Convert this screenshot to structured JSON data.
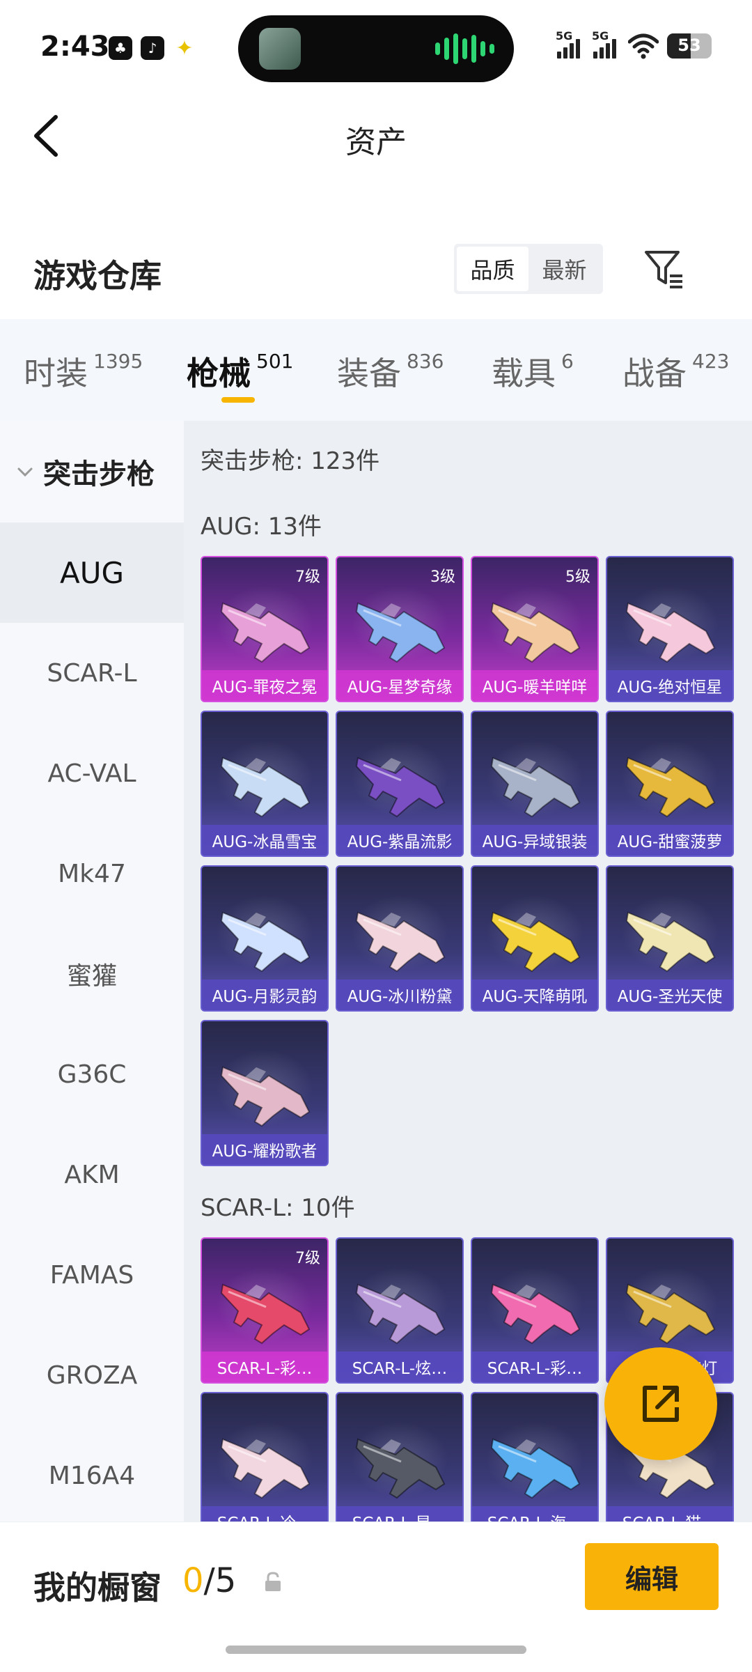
{
  "status_bar": {
    "time": "2:43",
    "signal1": "5G",
    "signal2": "5G",
    "battery": "53"
  },
  "header": {
    "title": "资产"
  },
  "toolbar": {
    "section_title": "游戏仓库",
    "sort_options": [
      "品质",
      "最新"
    ],
    "sort_active": "品质"
  },
  "tabs": [
    {
      "label": "时装",
      "count": "1395"
    },
    {
      "label": "枪械",
      "count": "501",
      "active": true
    },
    {
      "label": "装备",
      "count": "836"
    },
    {
      "label": "载具",
      "count": "6"
    },
    {
      "label": "战备",
      "count": "423"
    }
  ],
  "sidebar": {
    "category": "突击步枪",
    "items": [
      "AUG",
      "SCAR-L",
      "AC-VAL",
      "Mk47",
      "蜜獾",
      "G36C",
      "AKM",
      "FAMAS",
      "GROZA",
      "M16A4"
    ],
    "active": "AUG"
  },
  "content": {
    "category_total": "突击步枪: 123件",
    "groups": [
      {
        "heading": "AUG: 13件",
        "items": [
          {
            "name": "AUG-罪夜之冕",
            "level": "7级",
            "rarity": "rare"
          },
          {
            "name": "AUG-星梦奇缘",
            "level": "3级",
            "rarity": "rare"
          },
          {
            "name": "AUG-暖羊咩咩",
            "level": "5级",
            "rarity": "rare"
          },
          {
            "name": "AUG-绝对恒星",
            "level": "",
            "rarity": "epic"
          },
          {
            "name": "AUG-冰晶雪宝",
            "level": "",
            "rarity": "epic"
          },
          {
            "name": "AUG-紫晶流影",
            "level": "",
            "rarity": "epic"
          },
          {
            "name": "AUG-异域银装",
            "level": "",
            "rarity": "epic"
          },
          {
            "name": "AUG-甜蜜菠萝",
            "level": "",
            "rarity": "epic"
          },
          {
            "name": "AUG-月影灵韵",
            "level": "",
            "rarity": "epic"
          },
          {
            "name": "AUG-冰川粉黛",
            "level": "",
            "rarity": "epic"
          },
          {
            "name": "AUG-天降萌吼",
            "level": "",
            "rarity": "epic"
          },
          {
            "name": "AUG-圣光天使",
            "level": "",
            "rarity": "epic"
          },
          {
            "name": "AUG-耀粉歌者",
            "level": "",
            "rarity": "epic"
          }
        ]
      },
      {
        "heading": "SCAR-L: 10件",
        "items": [
          {
            "name": "SCAR-L-彩…",
            "level": "7级",
            "rarity": "rare"
          },
          {
            "name": "SCAR-L-炫…",
            "level": "",
            "rarity": "epic"
          },
          {
            "name": "SCAR-L-彩…",
            "level": "",
            "rarity": "epic"
          },
          {
            "name": "SCAR-L-夜灯",
            "level": "",
            "rarity": "epic"
          },
          {
            "name": "SCAR-L-冷…",
            "level": "",
            "rarity": "epic"
          },
          {
            "name": "SCAR-L-星…",
            "level": "",
            "rarity": "epic"
          },
          {
            "name": "SCAR-L-海…",
            "level": "",
            "rarity": "epic"
          },
          {
            "name": "SCAR-L-猫…",
            "level": "",
            "rarity": "epic"
          }
        ]
      }
    ]
  },
  "showcase": {
    "label": "我的橱窗",
    "current": "0",
    "total": "/5",
    "edit_label": "编辑"
  },
  "colors": {
    "accent": "#f9b208",
    "rare": "#c33fc7",
    "epic": "#5d53b6"
  },
  "icons": {
    "back": "chevron-left-icon",
    "filter": "filter-icon",
    "share": "share-external-icon",
    "lock": "lock-icon"
  }
}
